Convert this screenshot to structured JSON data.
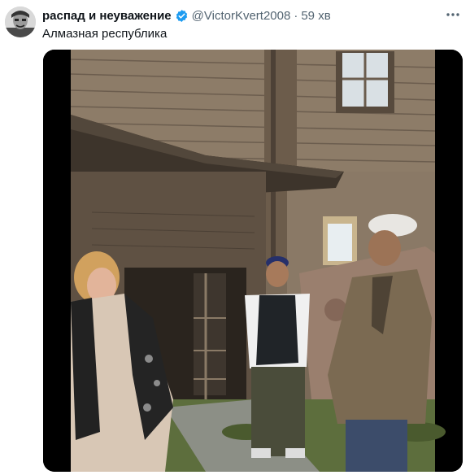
{
  "tweet": {
    "author_name": "распад и неуважение",
    "handle": "@VictorKvert2008",
    "separator": "·",
    "time": "59 хв",
    "text": "Алмазная республика",
    "verified": true,
    "more_icon": "more-horizontal-icon",
    "avatar_icon": "avatar-photo",
    "media": "video-still"
  },
  "colors": {
    "text": "#0f1419",
    "muted": "#536471",
    "verified_blue": "#1d9bf0",
    "media_bg": "#000000"
  }
}
